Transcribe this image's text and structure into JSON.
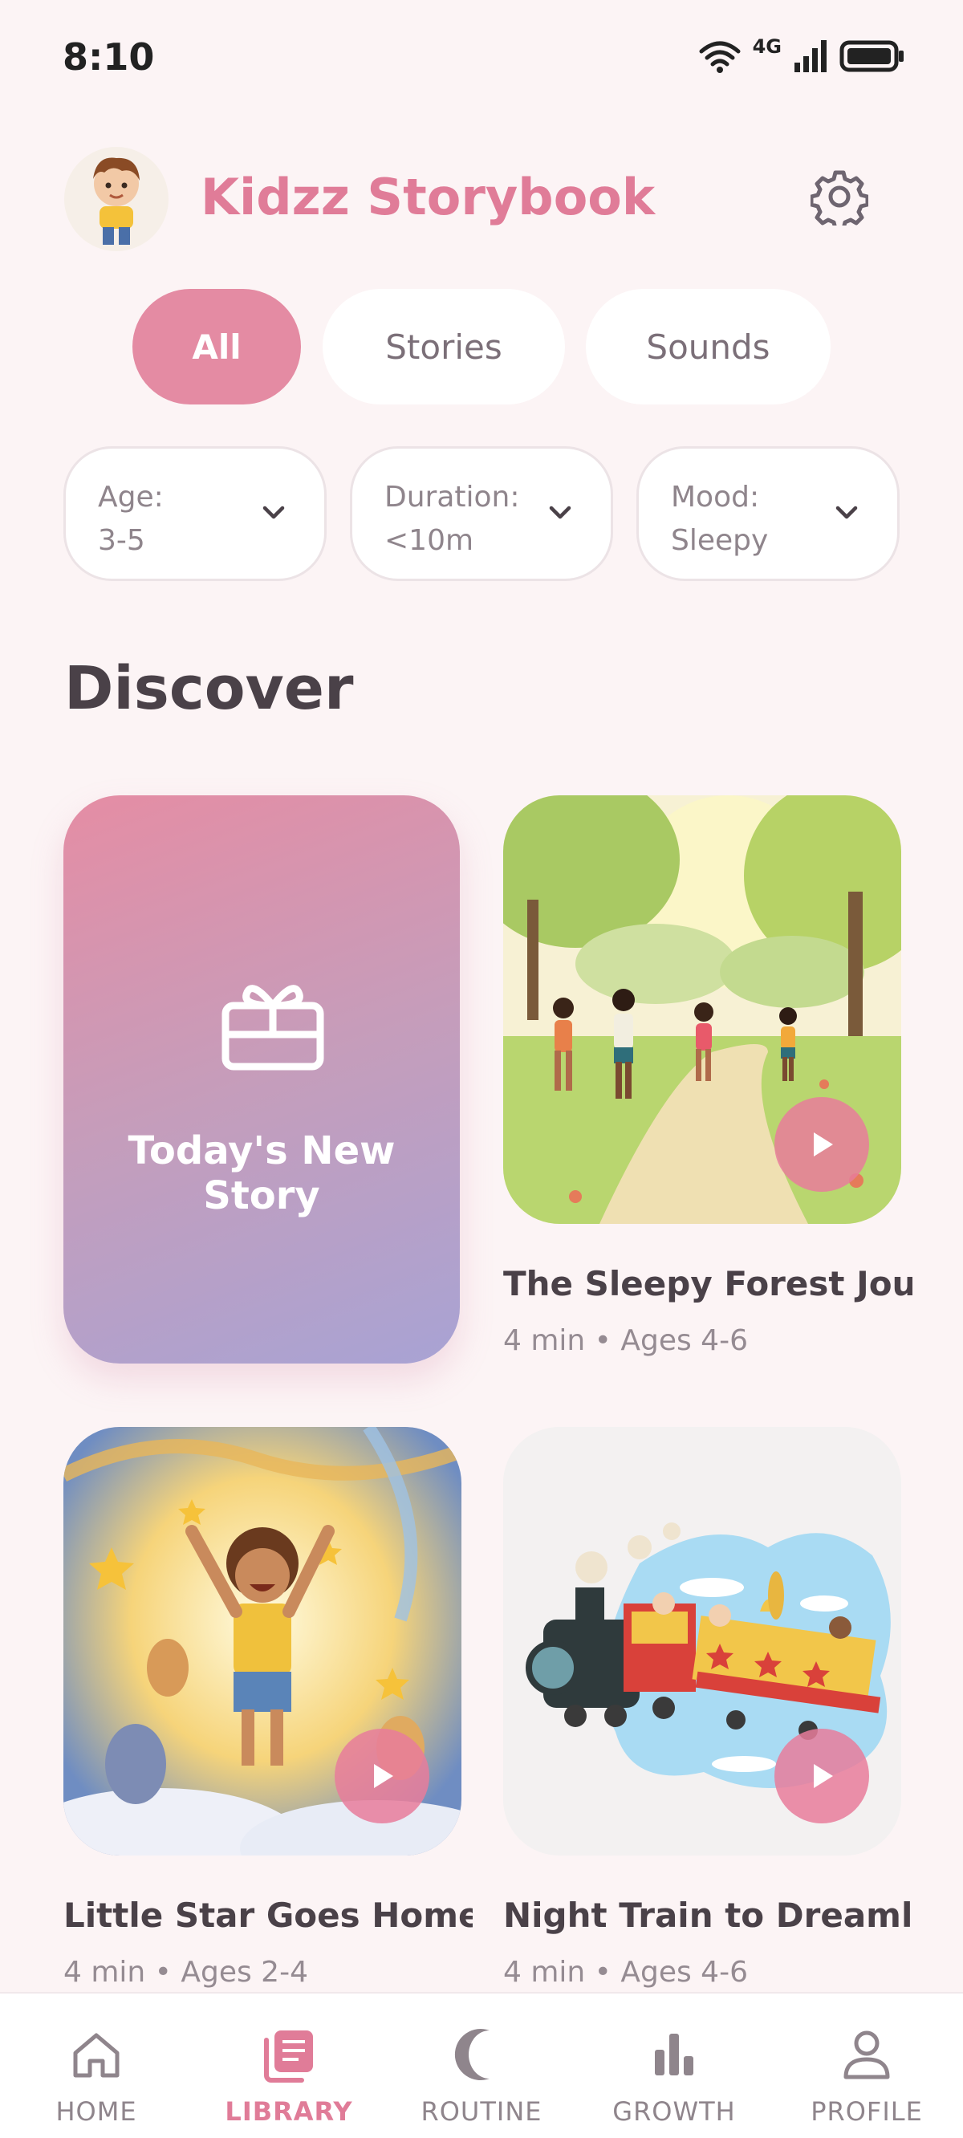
{
  "status_bar": {
    "time": "8:10",
    "network": "4G"
  },
  "header": {
    "title": "Kidzz Storybook",
    "avatar_icon": "boy-avatar",
    "settings_icon": "gear-icon"
  },
  "tabs": [
    {
      "label": "All",
      "active": true
    },
    {
      "label": "Stories",
      "active": false
    },
    {
      "label": "Sounds",
      "active": false
    }
  ],
  "filters": [
    {
      "text": "Age:\n3-5"
    },
    {
      "text": "Duration:\n<10m"
    },
    {
      "text": "Mood:\nSleepy"
    }
  ],
  "section_title": "Discover",
  "featured": {
    "label": "Today's New Story",
    "icon": "gift-icon"
  },
  "stories": [
    {
      "title": "The Sleepy Forest Jou...",
      "meta": "4 min • Ages 4-6"
    },
    {
      "title": "Little Star Goes Home",
      "meta": "4 min • Ages 2-4"
    },
    {
      "title": "Night Train to Dreaml...",
      "meta": "4 min • Ages 4-6"
    }
  ],
  "nav": [
    {
      "label": "HOME",
      "icon": "home-icon",
      "active": false
    },
    {
      "label": "LIBRARY",
      "icon": "library-icon",
      "active": true
    },
    {
      "label": "ROUTINE",
      "icon": "moon-icon",
      "active": false
    },
    {
      "label": "GROWTH",
      "icon": "bar-chart-icon",
      "active": false
    },
    {
      "label": "PROFILE",
      "icon": "person-icon",
      "active": false
    }
  ],
  "colors": {
    "accent": "#e07c98",
    "background": "#fcf4f5",
    "tab_active": "#e48ba3"
  }
}
